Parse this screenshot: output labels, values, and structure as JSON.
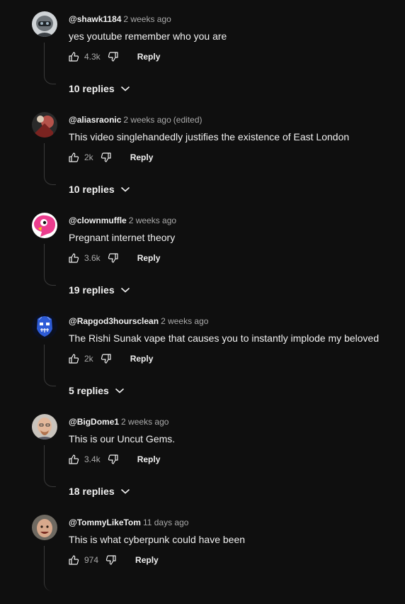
{
  "comments": [
    {
      "author": "@shawk1184",
      "time": "2 weeks ago",
      "edited": "",
      "text": "yes youtube remember who you are",
      "likes": "4.3k",
      "reply_label": "Reply",
      "replies_label": "10 replies",
      "avatar_icon": "helmet-avatar-icon"
    },
    {
      "author": "@aliasraonic",
      "time": "2 weeks ago",
      "edited": "(edited)",
      "text": "This video singlehandedly justifies the existence of East London",
      "likes": "2k",
      "reply_label": "Reply",
      "replies_label": "10 replies",
      "avatar_icon": "photo-avatar-icon"
    },
    {
      "author": "@clownmuffle",
      "time": "2 weeks ago",
      "edited": "",
      "text": "Pregnant internet theory",
      "likes": "3.6k",
      "reply_label": "Reply",
      "replies_label": "19 replies",
      "avatar_icon": "pink-character-avatar-icon"
    },
    {
      "author": "@Rapgod3hoursclean",
      "time": "2 weeks ago",
      "edited": "",
      "text": "The Rishi Sunak vape that causes you to instantly implode my beloved",
      "likes": "2k",
      "reply_label": "Reply",
      "replies_label": "5 replies",
      "avatar_icon": "blue-skull-avatar-icon"
    },
    {
      "author": "@BigDome1",
      "time": "2 weeks ago",
      "edited": "",
      "text": "This is our Uncut Gems.",
      "likes": "3.4k",
      "reply_label": "Reply",
      "replies_label": "18 replies",
      "avatar_icon": "face-photo-avatar-icon"
    },
    {
      "author": "@TommyLikeTom",
      "time": "11 days ago",
      "edited": "",
      "text": "This is what cyberpunk could have been",
      "likes": "974",
      "reply_label": "Reply",
      "replies_label": "",
      "avatar_icon": "face-photo-avatar-icon"
    }
  ],
  "colors": {
    "background": "#0f0f0f",
    "primary_text": "#f1f1f1",
    "secondary_text": "#aaaaaa",
    "thread_line": "#3a3a3a"
  }
}
